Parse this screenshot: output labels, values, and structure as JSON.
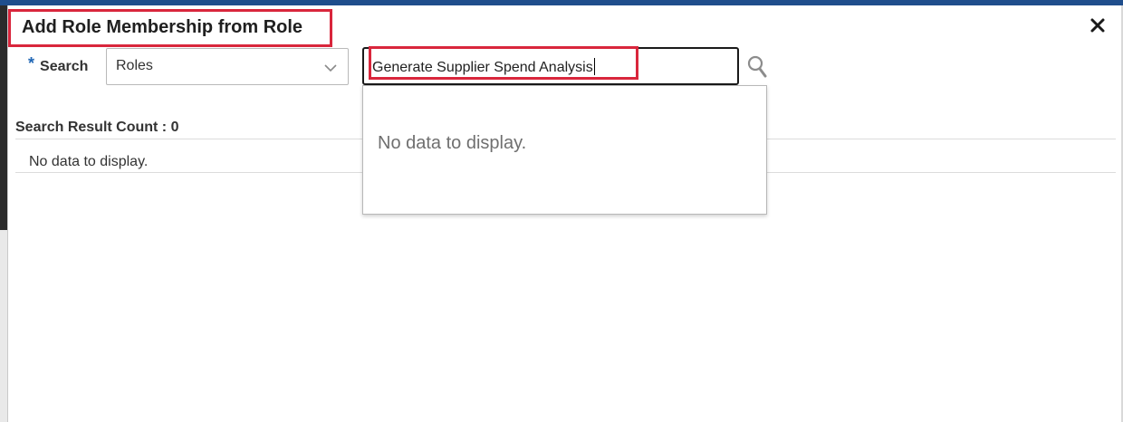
{
  "dialog": {
    "title": "Add Role Membership from Role",
    "close_icon": "close-icon"
  },
  "search": {
    "required_marker": "*",
    "label": "Search",
    "type_select": {
      "selected": "Roles",
      "icon": "chevron-down-icon"
    },
    "query": {
      "value": "Generate Supplier Spend Analysis"
    },
    "search_icon": "search-icon"
  },
  "dropdown": {
    "empty_message": "No data to display."
  },
  "results": {
    "count_label": "Search Result Count : 0",
    "empty_message": "No data to display."
  },
  "colors": {
    "highlight": "#d9263c",
    "topbar": "#1f4e8c",
    "required_star": "#1f66b5"
  }
}
